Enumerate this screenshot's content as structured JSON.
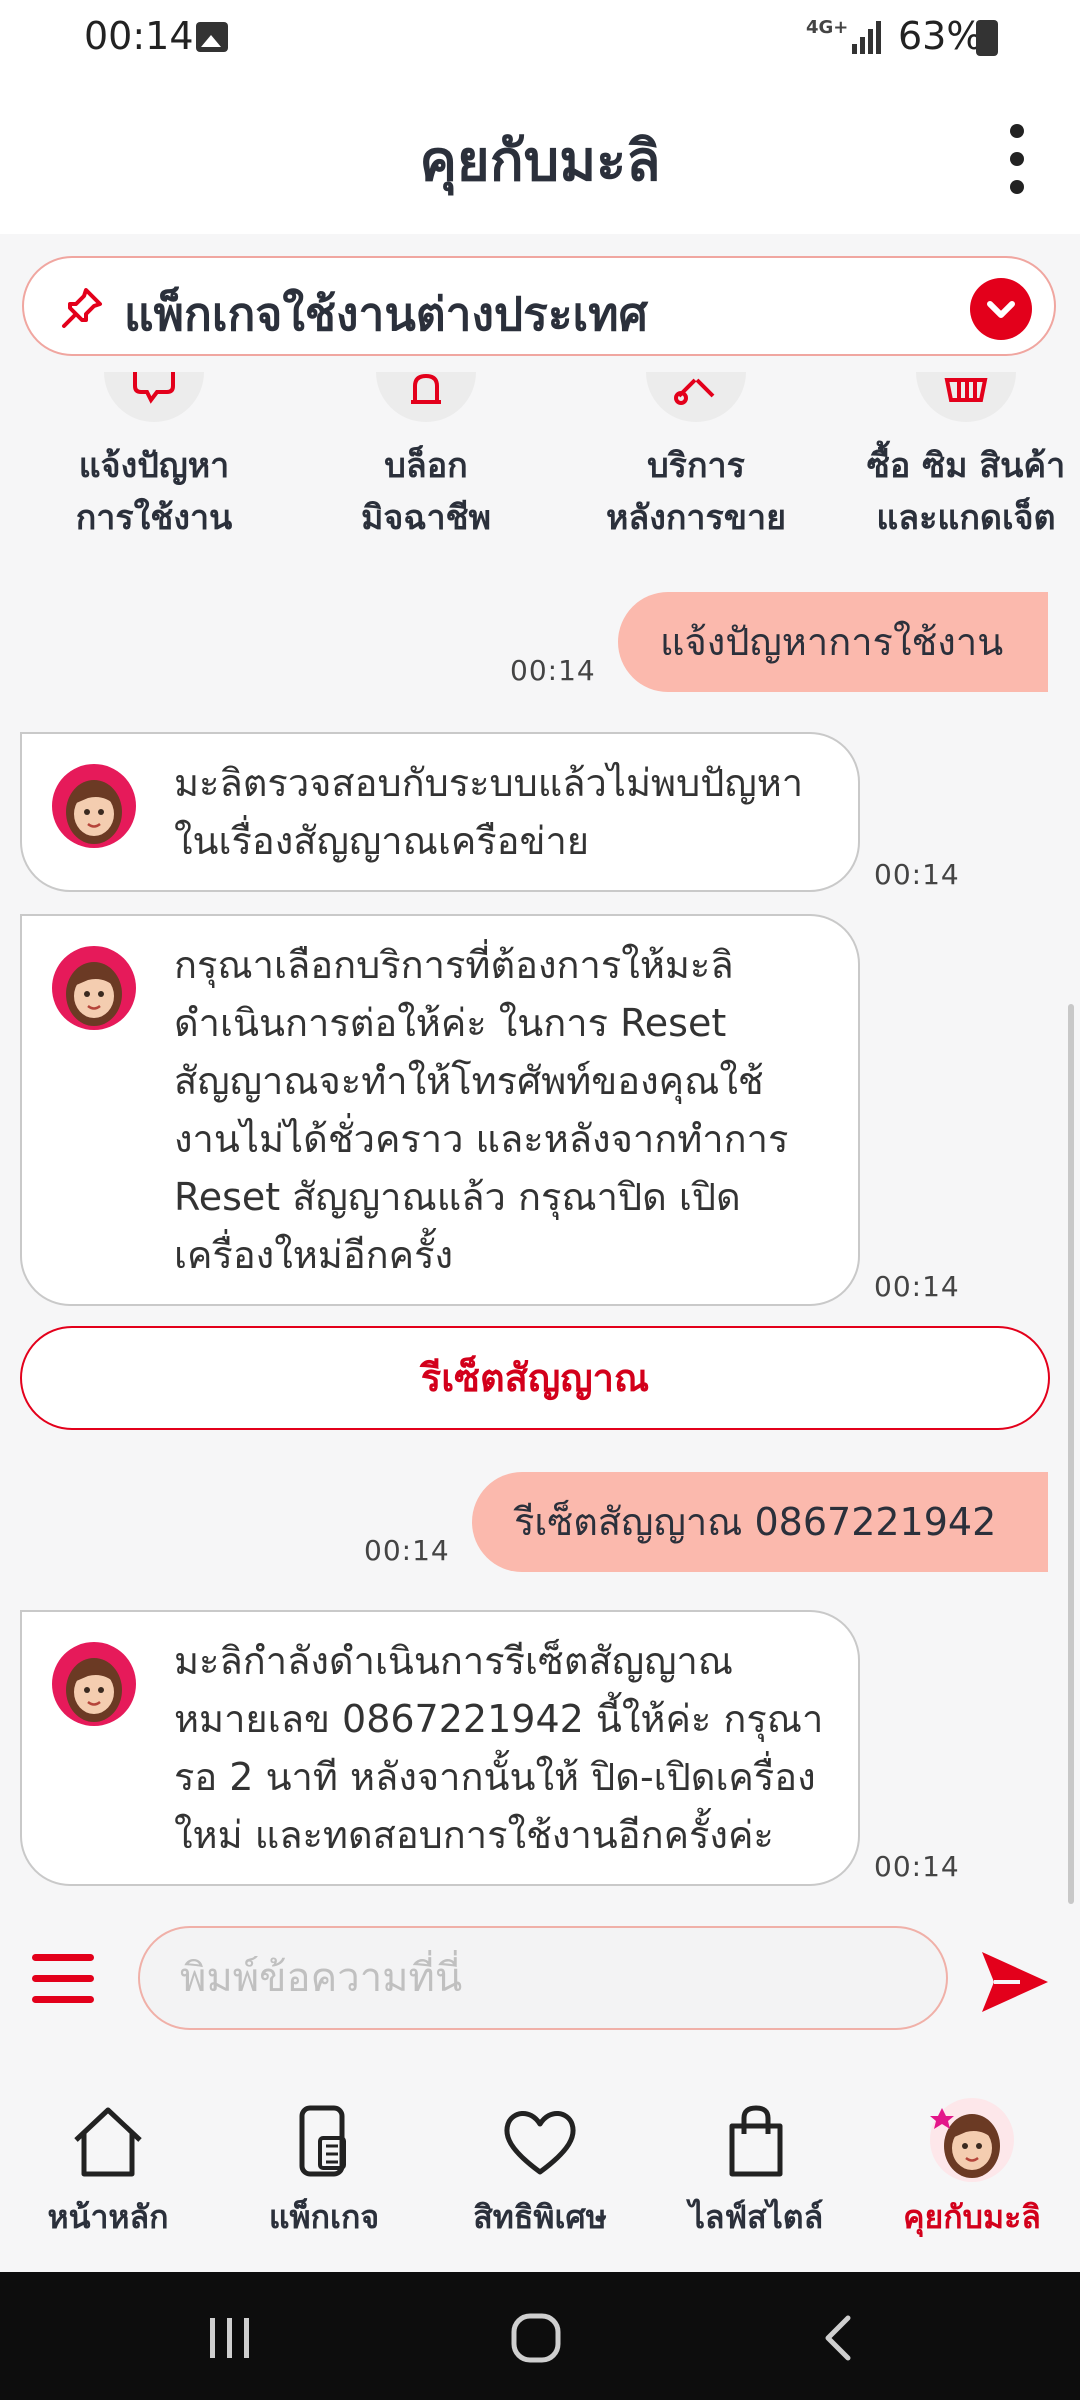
{
  "status_bar": {
    "time": "00:14",
    "network": "4G+",
    "battery": "63%"
  },
  "header": {
    "title": "คุยกับมะลิ"
  },
  "pinned": {
    "label": "แพ็กเกจใช้งานต่างประเทศ"
  },
  "menu": [
    {
      "line1": "แจ้งปัญหา",
      "line2": "การใช้งาน"
    },
    {
      "line1": "บล็อก",
      "line2": "มิจฉาชีพ"
    },
    {
      "line1": "บริการ",
      "line2": "หลังการขาย"
    },
    {
      "line1": "ซื้อ ซิม สินค้า",
      "line2": "และแกดเจ็ต"
    }
  ],
  "chat": {
    "msg1": {
      "text": "แจ้งปัญหาการใช้งาน",
      "time": "00:14"
    },
    "msg2": {
      "line1": "มะลิตรวจสอบกับระบบแล้วไม่พบปัญหา",
      "line2": "ในเรื่องสัญญาณเครือข่าย",
      "time": "00:14"
    },
    "msg3": {
      "line1": "กรุณาเลือกบริการที่ต้องการให้มะลิ",
      "line2": "ดำเนินการต่อให้ค่ะ ในการ Reset",
      "line3": "สัญญาณจะทำให้โทรศัพท์ของคุณใช้",
      "line4": "งานไม่ได้ชั่วคราว และหลังจากทำการ",
      "line5": "Reset สัญญาณแล้ว กรุณาปิด เปิด",
      "line6": "เครื่องใหม่อีกครั้ง",
      "time": "00:14"
    },
    "reset_button": "รีเซ็ตสัญญาณ",
    "msg4": {
      "text": "รีเซ็ตสัญญาณ 0867221942",
      "time": "00:14"
    },
    "msg5": {
      "line1": "มะลิกำลังดำเนินการรีเซ็ตสัญญาณ",
      "line2": "หมายเลข 0867221942 นี้ให้ค่ะ กรุณา",
      "line3": "รอ 2 นาที หลังจากนั้นให้ ปิด-เปิดเครื่อง",
      "line4": "ใหม่ และทดสอบการใช้งานอีกครั้งค่ะ",
      "time": "00:14"
    }
  },
  "input": {
    "placeholder": "พิมพ์ข้อความที่นี่"
  },
  "nav": [
    {
      "label": "หน้าหลัก",
      "icon": "home-icon"
    },
    {
      "label": "แพ็กเกจ",
      "icon": "package-icon"
    },
    {
      "label": "สิทธิพิเศษ",
      "icon": "heart-icon"
    },
    {
      "label": "ไลฟ์สไตล์",
      "icon": "shopping-bag-icon"
    },
    {
      "label": "คุยกับมะลิ",
      "icon": "mali-avatar-icon",
      "active": true
    }
  ],
  "colors": {
    "accent": "#e3001b",
    "user_bubble": "#fbb9ad",
    "background": "#f6f6f7"
  }
}
